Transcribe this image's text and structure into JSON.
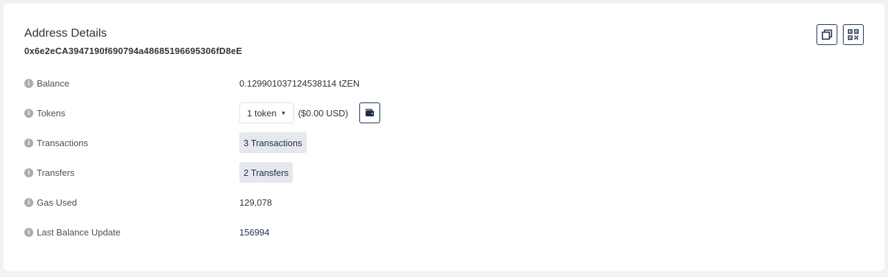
{
  "header": {
    "title": "Address Details",
    "address": "0x6e2eCA3947190f690794a48685196695306fD8eE"
  },
  "actions": {
    "copy_icon": "copy-icon",
    "qr_icon": "qr-code-icon"
  },
  "details": {
    "balance": {
      "label": "Balance",
      "value": "0.129901037124538114 tZEN"
    },
    "tokens": {
      "label": "Tokens",
      "dropdown": "1 token",
      "usd": "($0.00 USD)",
      "wallet_icon": "wallet-icon"
    },
    "transactions": {
      "label": "Transactions",
      "value": "3 Transactions"
    },
    "transfers": {
      "label": "Transfers",
      "value": "2 Transfers"
    },
    "gas_used": {
      "label": "Gas Used",
      "value": "129,078"
    },
    "last_balance_update": {
      "label": "Last Balance Update",
      "value": "156994"
    }
  },
  "colors": {
    "accent": "#1a2b4b",
    "pill_bg": "#e6e8ee",
    "page_bg": "#f1f2f6"
  }
}
